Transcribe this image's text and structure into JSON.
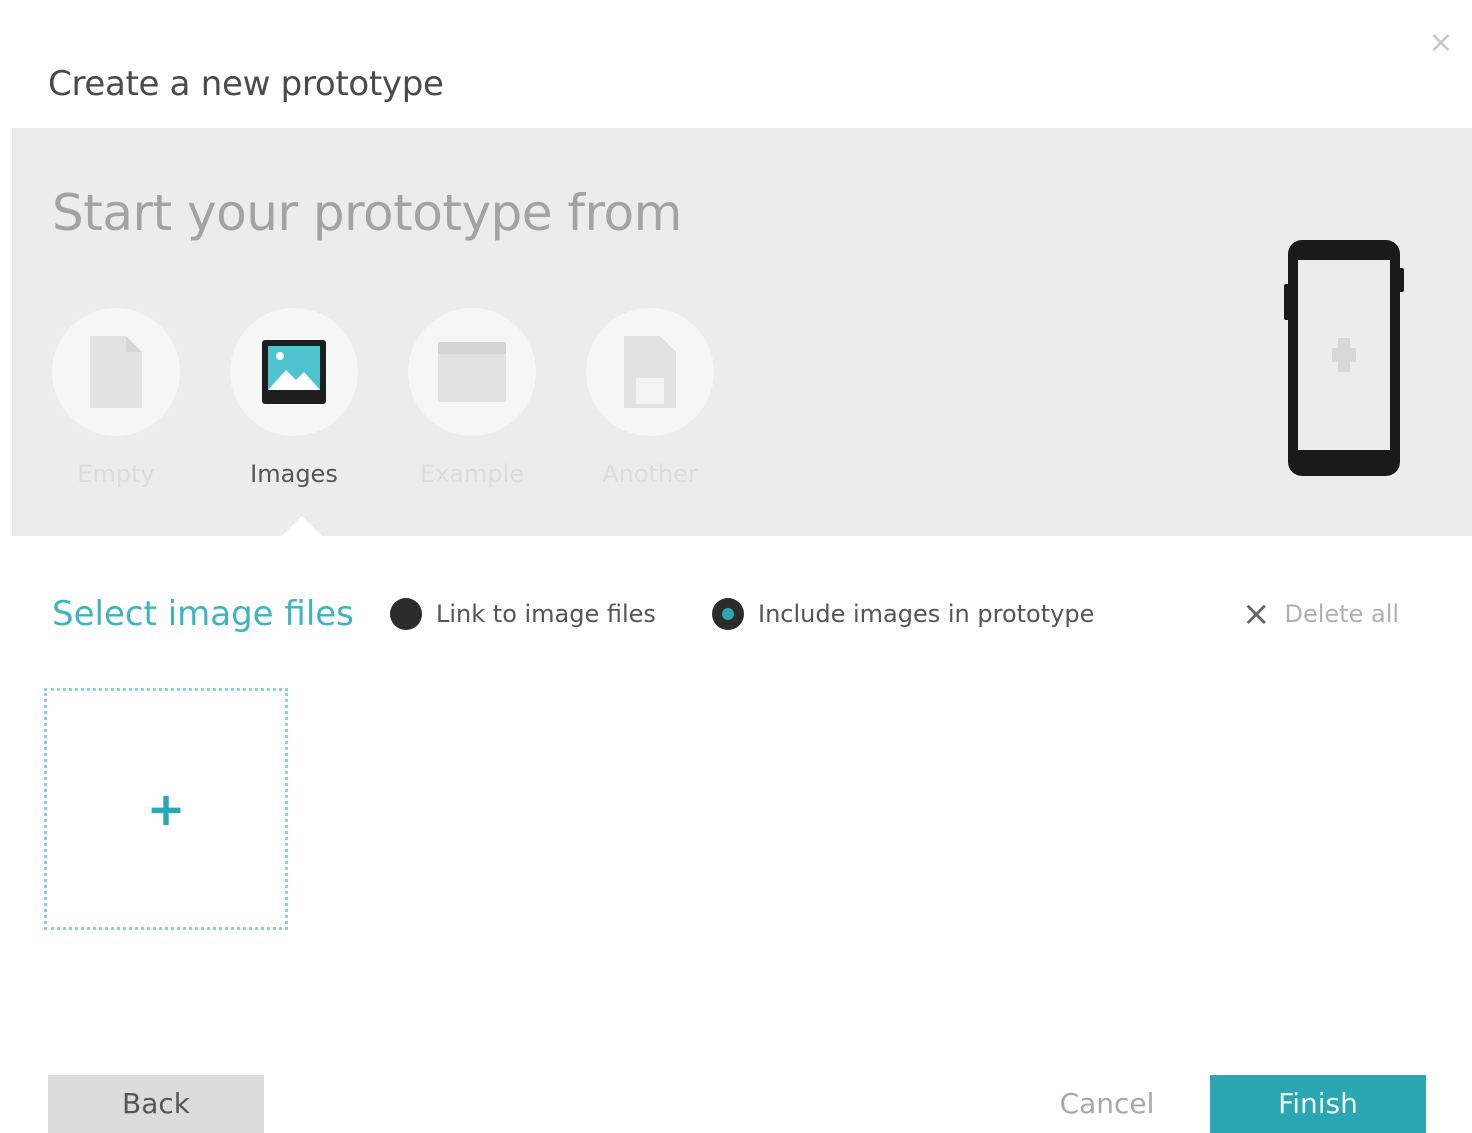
{
  "dialog": {
    "title": "Create a new prototype",
    "close_label": "×"
  },
  "source_panel": {
    "heading": "Start your prototype from",
    "options": [
      {
        "label": "Empty",
        "icon": "document-icon",
        "selected": false
      },
      {
        "label": "Images",
        "icon": "image-icon",
        "selected": true
      },
      {
        "label": "Example",
        "icon": "window-icon",
        "selected": false
      },
      {
        "label": "Another",
        "icon": "file-icon",
        "selected": false
      }
    ],
    "device_icon": "smartphone-icon"
  },
  "images_toolbar": {
    "select_label": "Select image files",
    "radio_link_label": "Link to image files",
    "radio_include_label": "Include images in prototype",
    "selected_mode": "include",
    "delete_all_label": "Delete all",
    "delete_icon": "×"
  },
  "dropzone": {
    "plus_label": "+"
  },
  "footer": {
    "back_label": "Back",
    "cancel_label": "Cancel",
    "finish_label": "Finish"
  },
  "colors": {
    "accent": "#2aa7b3",
    "link": "#3fb4bf",
    "panel_bg": "#ececec"
  }
}
